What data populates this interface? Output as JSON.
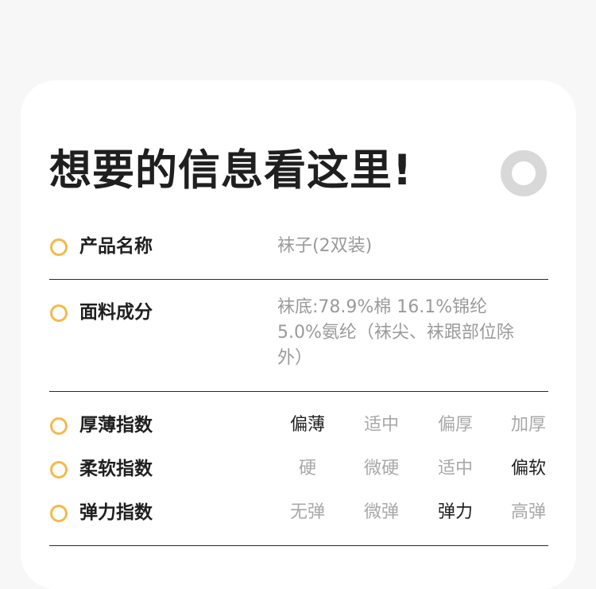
{
  "header": {
    "title": "想要的信息看这里!"
  },
  "product": {
    "label": "产品名称",
    "value": "袜子(2双装)"
  },
  "fabric": {
    "label": "面料成分",
    "value": "袜底:78.9%棉 16.1%锦纶 5.0%氨纶（袜尖、袜跟部位除外）"
  },
  "indices": [
    {
      "label": "厚薄指数",
      "options": [
        "偏薄",
        "适中",
        "偏厚",
        "加厚"
      ],
      "selected": "偏薄"
    },
    {
      "label": "柔软指数",
      "options": [
        "硬",
        "微硬",
        "适中",
        "偏软"
      ],
      "selected": "偏软"
    },
    {
      "label": "弹力指数",
      "options": [
        "无弹",
        "微弹",
        "弹力",
        "高弹"
      ],
      "selected": "弹力"
    }
  ],
  "colors": {
    "bullet": "#f5b94a",
    "selected": "#1f1f1f",
    "unselected": "#a8a8a8",
    "value": "#9a9a9a"
  },
  "icons": {
    "decoration": "ring-icon",
    "bullet": "circle-bullet-icon"
  }
}
